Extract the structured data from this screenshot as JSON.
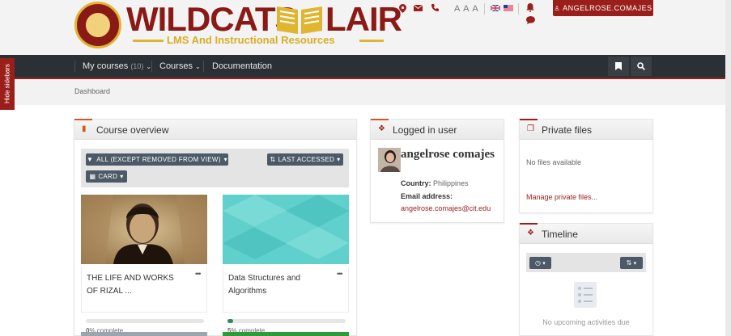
{
  "header": {
    "logo_left": "WILDCATS",
    "logo_right": "LAIR",
    "logo_subtitle": "LMS And Instructional Resources",
    "text_size_label": "A A A",
    "user_button": "ANGELROSE.COMAJES"
  },
  "nav": {
    "my_courses": "My courses",
    "my_courses_count": "(10)",
    "courses": "Courses",
    "documentation": "Documentation"
  },
  "hide_sidebars": "Hide sidebars",
  "breadcrumb": "Dashboard",
  "course_overview": {
    "title": "Course overview",
    "filter_label": "ALL (EXCEPT REMOVED FROM VIEW)",
    "sort_label": "LAST ACCESSED",
    "view_label": "CARD",
    "courses": [
      {
        "name": "THE LIFE AND WORKS OF RIZAL ...",
        "progress_label": "% complete",
        "progress_value": "0",
        "progress": 0
      },
      {
        "name": "Data Structures and Algorithms",
        "progress_label": "% complete",
        "progress_value": "5",
        "progress": 5
      }
    ]
  },
  "logged_in": {
    "title": "Logged in user",
    "name": "angelrose comajes",
    "country_label": "Country:",
    "country": "Philippines",
    "email_label": "Email address:",
    "email": "angelrose.comajes@cit.edu"
  },
  "private_files": {
    "title": "Private files",
    "empty": "No files available",
    "manage_link": "Manage private files..."
  },
  "timeline": {
    "title": "Timeline",
    "empty": "No upcoming activities due"
  },
  "colors": {
    "brand": "#9a1f1b",
    "navbar": "#2b3035",
    "gold": "#e0b530",
    "link": "#9a1f1b"
  }
}
